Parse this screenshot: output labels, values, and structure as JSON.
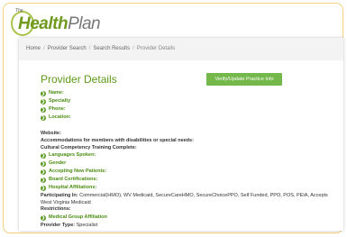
{
  "logo": {
    "small_text": "The",
    "word_bold": "Health",
    "word_rest": "Plan"
  },
  "breadcrumb": [
    {
      "label": "Home"
    },
    {
      "label": "Provider Search"
    },
    {
      "label": "Search Results"
    },
    {
      "label": "Provider Details"
    }
  ],
  "title": "Provider Details",
  "verify_button": "Verify/Update Practice Info",
  "fields": {
    "name": "Name:",
    "specialty": "Specialty",
    "phone": "Phone:",
    "location": "Location:",
    "website": "Website:",
    "accommodations": "Accommodations for members with disabilities or special needs:",
    "cultural": "Cultural Competency Training Complete:",
    "languages": "Languages Spoken:",
    "gender": "Gender",
    "accepting": "Accepting New Patients:",
    "board": "Board Certifications:",
    "hospital": "Hospital Affiliations:",
    "participating_label": "Participating In:",
    "participating_value": "Commercial(HMO), WV Medicaid, SecureCareHMO, SecureChoicePPO, Self Funded, PPO, POS, PEIA, Accepts West Virginia Medicaid",
    "restrictions": "Restrictions:",
    "medical_group": "Medical Group Affiliation",
    "provider_type_label": "Provider Type:",
    "provider_type_value": "Specialist"
  },
  "icon_glyph": "❯"
}
